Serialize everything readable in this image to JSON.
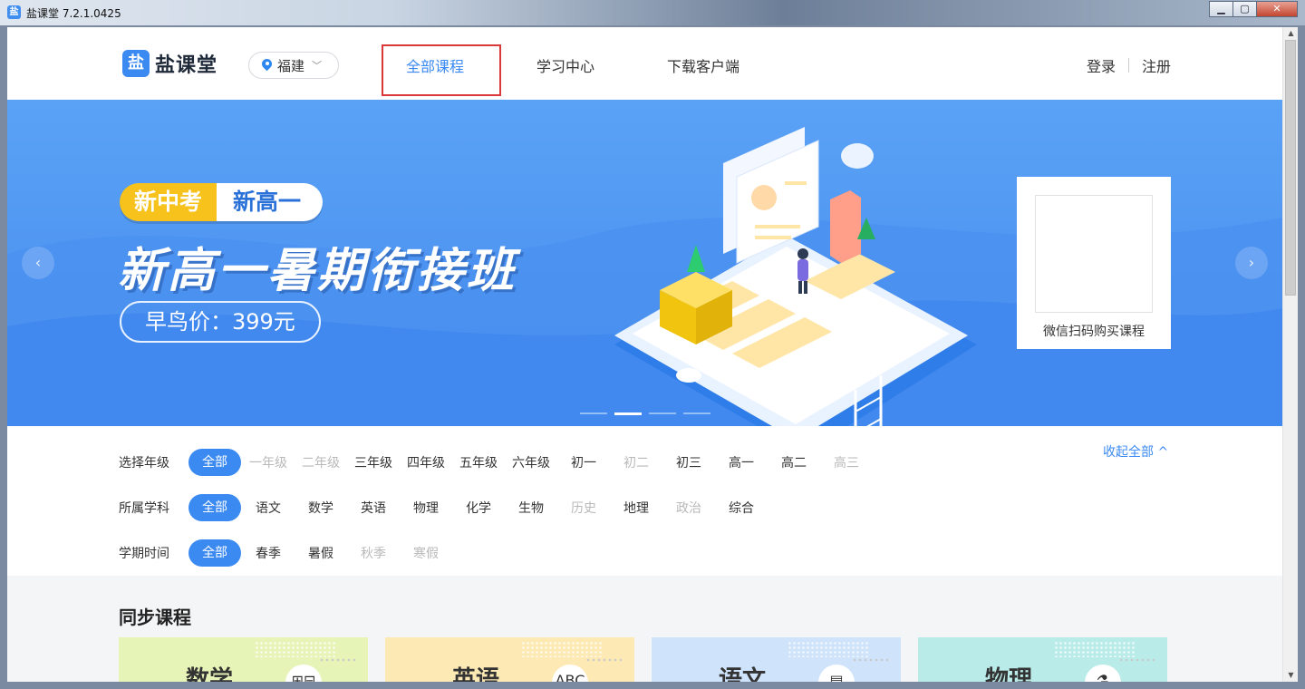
{
  "window": {
    "title": "盐课堂 7.2.1.0425",
    "app_icon": "盐",
    "buttons": [
      "minimize",
      "maximize",
      "close"
    ]
  },
  "header": {
    "logo_mark": "盐",
    "logo_text": "盐课堂",
    "region": "福建",
    "nav": [
      {
        "label": "全部课程",
        "active": true
      },
      {
        "label": "学习中心",
        "active": false
      },
      {
        "label": "下载客户端",
        "active": false
      }
    ],
    "login": "登录",
    "register": "注册"
  },
  "banner": {
    "tag_left": "新中考",
    "tag_right": "新高一",
    "headline": "新高一暑期衔接班",
    "price": "早鸟价：399元",
    "qr_label": "微信扫码购买课程",
    "prev": "‹",
    "next": "›",
    "active_slide": 2,
    "slide_count": 4
  },
  "filters": {
    "collapse_label": "收起全部 ^",
    "grade": {
      "label": "选择年级",
      "options": [
        {
          "text": "全部",
          "state": "selected"
        },
        {
          "text": "一年级",
          "state": "disabled"
        },
        {
          "text": "二年级",
          "state": "disabled"
        },
        {
          "text": "三年级",
          "state": "normal"
        },
        {
          "text": "四年级",
          "state": "normal"
        },
        {
          "text": "五年级",
          "state": "normal"
        },
        {
          "text": "六年级",
          "state": "normal"
        },
        {
          "text": "初一",
          "state": "normal"
        },
        {
          "text": "初二",
          "state": "disabled"
        },
        {
          "text": "初三",
          "state": "normal"
        },
        {
          "text": "高一",
          "state": "normal"
        },
        {
          "text": "高二",
          "state": "normal"
        },
        {
          "text": "高三",
          "state": "disabled"
        }
      ]
    },
    "subject": {
      "label": "所属学科",
      "options": [
        {
          "text": "全部",
          "state": "selected"
        },
        {
          "text": "语文",
          "state": "normal"
        },
        {
          "text": "数学",
          "state": "normal"
        },
        {
          "text": "英语",
          "state": "normal"
        },
        {
          "text": "物理",
          "state": "normal"
        },
        {
          "text": "化学",
          "state": "normal"
        },
        {
          "text": "生物",
          "state": "normal"
        },
        {
          "text": "历史",
          "state": "disabled"
        },
        {
          "text": "地理",
          "state": "normal"
        },
        {
          "text": "政治",
          "state": "disabled"
        },
        {
          "text": "综合",
          "state": "normal"
        }
      ]
    },
    "term": {
      "label": "学期时间",
      "options": [
        {
          "text": "全部",
          "state": "selected"
        },
        {
          "text": "春季",
          "state": "normal"
        },
        {
          "text": "暑假",
          "state": "normal"
        },
        {
          "text": "秋季",
          "state": "disabled"
        },
        {
          "text": "寒假",
          "state": "disabled"
        }
      ]
    }
  },
  "courses": {
    "title": "同步课程",
    "cards": [
      {
        "name": "数学",
        "icon": "⊞⊟",
        "color": "#e7f4b8"
      },
      {
        "name": "英语",
        "icon": "ABC",
        "color": "#fde9b3"
      },
      {
        "name": "语文",
        "icon": "▤",
        "color": "#cfe3fb"
      },
      {
        "name": "物理",
        "icon": "⚗",
        "color": "#b9ece9"
      }
    ]
  }
}
